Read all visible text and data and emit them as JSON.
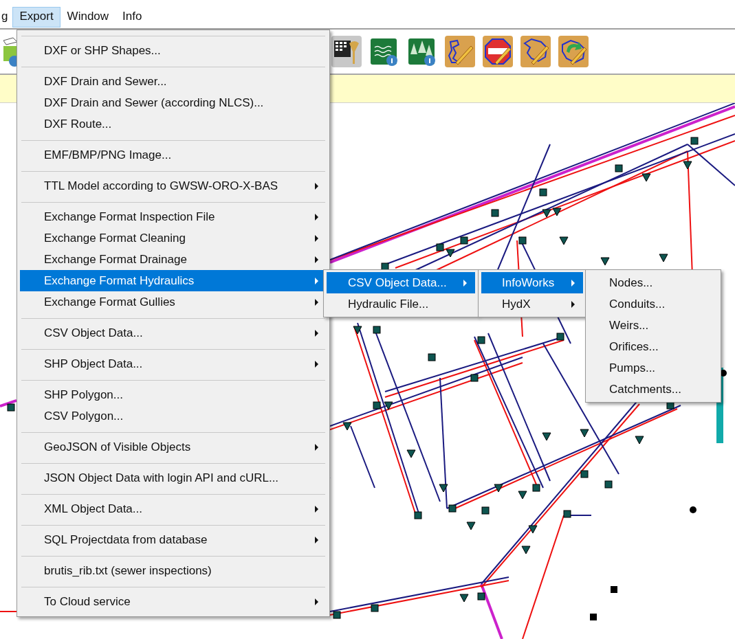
{
  "menubar": [
    {
      "label": "g",
      "selected": false
    },
    {
      "label": "Export",
      "selected": true
    },
    {
      "label": "Window",
      "selected": false
    },
    {
      "label": "Info",
      "selected": false
    }
  ],
  "export_menu": {
    "groups": [
      [
        {
          "label": "DXF or SHP Shapes...",
          "has_submenu": false,
          "selected": false
        }
      ],
      [
        {
          "label": "DXF Drain and Sewer...",
          "has_submenu": false,
          "selected": false
        },
        {
          "label": "DXF Drain and Sewer (according NLCS)...",
          "has_submenu": false,
          "selected": false
        },
        {
          "label": "DXF Route...",
          "has_submenu": false,
          "selected": false
        }
      ],
      [
        {
          "label": "EMF/BMP/PNG Image...",
          "has_submenu": false,
          "selected": false
        }
      ],
      [
        {
          "label": "TTL Model according to GWSW-ORO-X-BAS",
          "has_submenu": true,
          "selected": false
        }
      ],
      [
        {
          "label": "Exchange Format Inspection File",
          "has_submenu": true,
          "selected": false
        },
        {
          "label": "Exchange Format Cleaning",
          "has_submenu": true,
          "selected": false
        },
        {
          "label": "Exchange Format Drainage",
          "has_submenu": true,
          "selected": false
        },
        {
          "label": "Exchange Format Hydraulics",
          "has_submenu": true,
          "selected": true
        },
        {
          "label": "Exchange Format Gullies",
          "has_submenu": true,
          "selected": false
        }
      ],
      [
        {
          "label": "CSV Object Data...",
          "has_submenu": true,
          "selected": false
        }
      ],
      [
        {
          "label": "SHP Object Data...",
          "has_submenu": true,
          "selected": false
        }
      ],
      [
        {
          "label": "SHP Polygon...",
          "has_submenu": false,
          "selected": false
        },
        {
          "label": "CSV Polygon...",
          "has_submenu": false,
          "selected": false
        }
      ],
      [
        {
          "label": "GeoJSON of Visible Objects",
          "has_submenu": true,
          "selected": false
        }
      ],
      [
        {
          "label": "JSON Object Data with login API and cURL...",
          "has_submenu": false,
          "selected": false
        }
      ],
      [
        {
          "label": "XML Object Data...",
          "has_submenu": true,
          "selected": false
        }
      ],
      [
        {
          "label": "SQL Projectdata from database",
          "has_submenu": true,
          "selected": false
        }
      ],
      [
        {
          "label": "brutis_rib.txt (sewer inspections)",
          "has_submenu": false,
          "selected": false
        }
      ],
      [
        {
          "label": "To Cloud service",
          "has_submenu": true,
          "selected": false
        }
      ]
    ]
  },
  "hydraulics_submenu": [
    {
      "label": "CSV Object Data...",
      "has_submenu": true,
      "selected": true
    },
    {
      "label": "Hydraulic File...",
      "has_submenu": false,
      "selected": false
    }
  ],
  "csv_submenu": [
    {
      "label": "InfoWorks",
      "has_submenu": true,
      "selected": true
    },
    {
      "label": "HydX",
      "has_submenu": true,
      "selected": false
    }
  ],
  "infoworks_submenu": [
    {
      "label": "Nodes...",
      "has_submenu": false,
      "selected": false
    },
    {
      "label": "Conduits...",
      "has_submenu": false,
      "selected": false
    },
    {
      "label": "Weirs...",
      "has_submenu": false,
      "selected": false
    },
    {
      "label": "Orifices...",
      "has_submenu": false,
      "selected": false
    },
    {
      "label": "Pumps...",
      "has_submenu": false,
      "selected": false
    },
    {
      "label": "Catchments...",
      "has_submenu": false,
      "selected": false
    }
  ]
}
